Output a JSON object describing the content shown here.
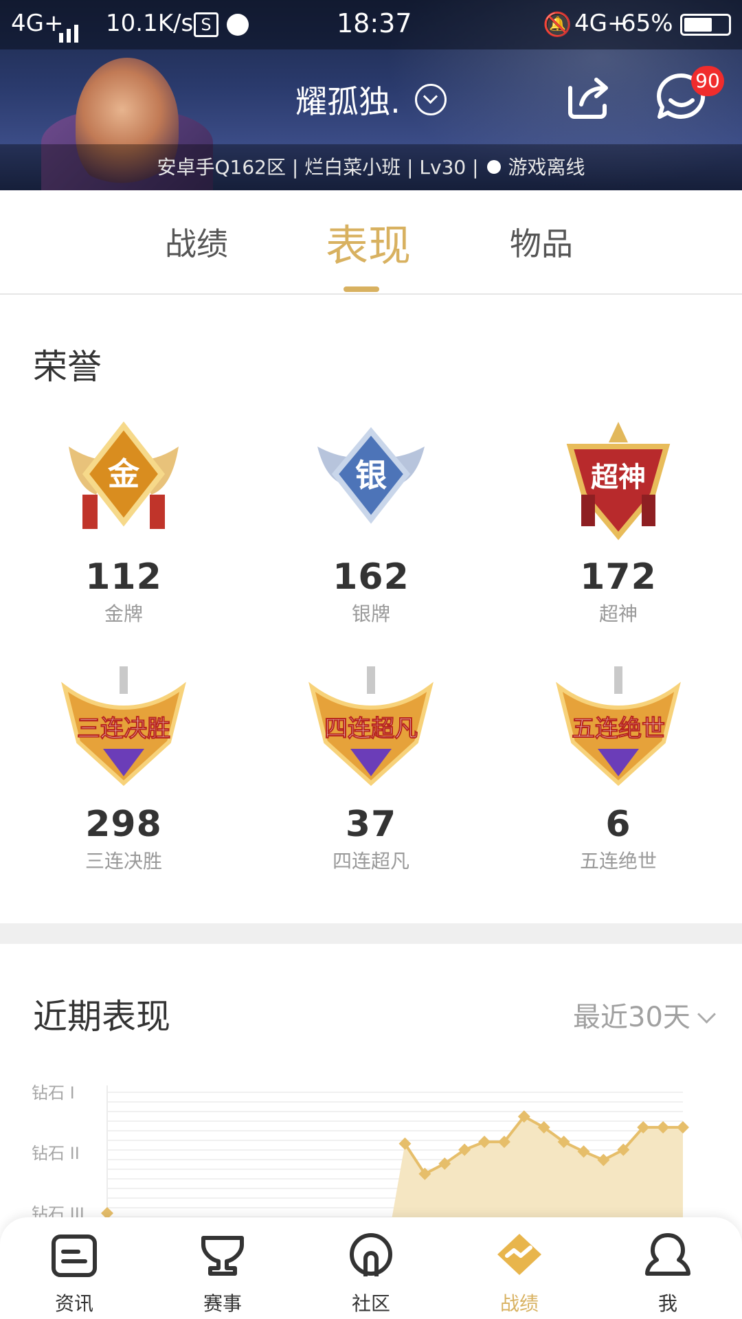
{
  "status_bar": {
    "network": "4G+",
    "speed": "10.1K/s",
    "time": "18:37",
    "network_right": "4G+",
    "battery": "65%",
    "battery_level": 0.65
  },
  "header": {
    "player_name": "耀孤独.",
    "message_badge": "90",
    "sub_info": "安卓手Q162区 | 烂白菜小班 | Lv30 |",
    "online_status": "游戏离线"
  },
  "tabs": [
    "战绩",
    "表现",
    "物品"
  ],
  "active_tab": "表现",
  "honors": {
    "title": "荣誉",
    "items": [
      {
        "badge": "金",
        "count": "112",
        "label": "金牌",
        "color": "#d79a2b"
      },
      {
        "badge": "银",
        "count": "162",
        "label": "银牌",
        "color": "#5a7fc0"
      },
      {
        "badge": "超神",
        "count": "172",
        "label": "超神",
        "color": "#c0322f"
      },
      {
        "badge": "三连决胜",
        "count": "298",
        "label": "三连决胜",
        "color": "#e0502a"
      },
      {
        "badge": "四连超凡",
        "count": "37",
        "label": "四连超凡",
        "color": "#e0502a"
      },
      {
        "badge": "五连绝世",
        "count": "6",
        "label": "五连绝世",
        "color": "#e0502a"
      }
    ]
  },
  "recent": {
    "title": "近期表现",
    "range": "最近30天"
  },
  "chart_data": {
    "type": "area",
    "y_ticks": [
      "钻石 I",
      "钻石 II",
      "钻石 III"
    ],
    "y_tick_values": [
      3,
      2,
      1
    ],
    "values": [
      1.0,
      null,
      null,
      null,
      null,
      null,
      null,
      null,
      null,
      null,
      null,
      null,
      null,
      null,
      null,
      2.15,
      1.65,
      1.82,
      2.05,
      2.18,
      2.18,
      2.6,
      2.42,
      2.18,
      2.02,
      1.88,
      2.05,
      2.42,
      2.42,
      2.42
    ],
    "color": "#e6be6a",
    "fill": "#f5e6c2"
  },
  "bottom_nav": [
    {
      "label": "资讯",
      "icon": "news-icon"
    },
    {
      "label": "赛事",
      "icon": "trophy-icon"
    },
    {
      "label": "社区",
      "icon": "community-icon"
    },
    {
      "label": "战绩",
      "icon": "stats-icon"
    },
    {
      "label": "我",
      "icon": "profile-icon"
    }
  ],
  "active_nav": "战绩",
  "colors": {
    "accent": "#d8b160",
    "badge_red": "#f02c2c"
  }
}
